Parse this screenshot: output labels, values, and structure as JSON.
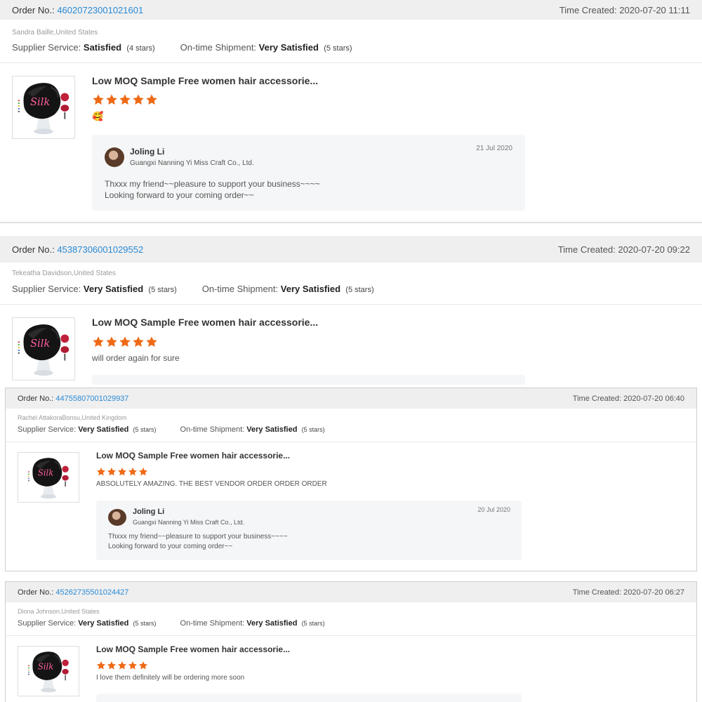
{
  "labels": {
    "order_no": "Order No.:",
    "time_created": "Time Created:",
    "supplier_service": "Supplier Service:",
    "ontime_shipment": "On-time Shipment:"
  },
  "product_name": "Low MOQ Sample Free women hair accessorie...",
  "product_image_logo_text": "Silk",
  "reviews": [
    {
      "order_no": "46020723001021601",
      "time_created": "2020-07-20 11:11",
      "buyer": "Sandra Baille,United States",
      "supplier_rating": "Satisfied",
      "supplier_stars": "(4 stars)",
      "shipment_rating": "Very Satisfied",
      "shipment_stars": "(5 stars)",
      "stars": 5,
      "comment": "🥰",
      "reply": {
        "name": "Joling Li",
        "company": "Guangxi Nanning Yi Miss Craft Co., Ltd.",
        "date": "21 Jul 2020",
        "message": "Thxxx my friend~~pleasure to support your business~~~~\nLooking forward to your coming order~~"
      }
    },
    {
      "order_no": "45387306001029552",
      "time_created": "2020-07-20 09:22",
      "buyer": "Tekeatha Davidson,United States",
      "supplier_rating": "Very Satisfied",
      "supplier_stars": "(5 stars)",
      "shipment_rating": "Very Satisfied",
      "shipment_stars": "(5 stars)",
      "stars": 5,
      "comment": "will order again for sure"
    },
    {
      "order_no": "44755807001029937",
      "time_created": "2020-07-20 06:40",
      "buyer": "Rachel AttakoraBonsu,United Kingdom",
      "supplier_rating": "Very Satisfied",
      "supplier_stars": "(5 stars)",
      "shipment_rating": "Very Satisfied",
      "shipment_stars": "(5 stars)",
      "stars": 5,
      "comment": "ABSOLUTELY AMAZING. THE BEST VENDOR ORDER ORDER ORDER",
      "reply": {
        "name": "Joling Li",
        "company": "Guangxi Nanning Yi Miss Craft Co., Ltd.",
        "date": "20 Jul 2020",
        "message": "Thxxx my friend~~pleasure to support your business~~~~\nLooking forward to your coming order~~"
      }
    },
    {
      "order_no": "45262735501024427",
      "time_created": "2020-07-20 06:27",
      "buyer": "Diona Johnson,United States",
      "supplier_rating": "Very Satisfied",
      "supplier_stars": "(5 stars)",
      "shipment_rating": "Very Satisfied",
      "shipment_stars": "(5 stars)",
      "stars": 5,
      "comment": "I love them definitely will be ordering more soon"
    }
  ],
  "colors": {
    "star": "#ef6a16",
    "link": "#2a8ad4",
    "header_bg": "#efefef"
  },
  "icons": [
    "star-icon",
    "avatar"
  ]
}
